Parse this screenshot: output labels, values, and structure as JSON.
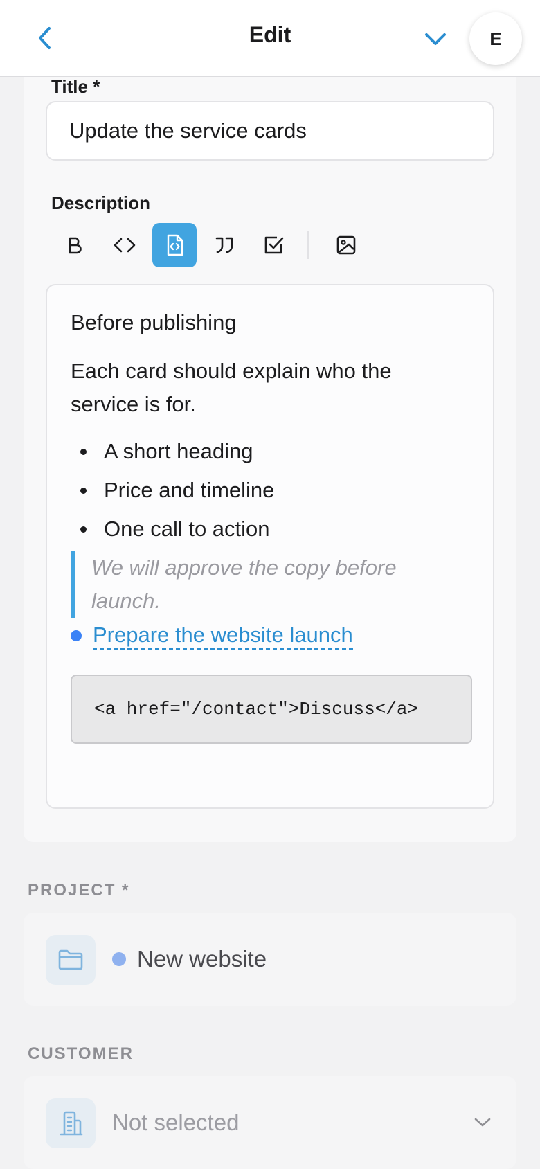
{
  "header": {
    "title": "Edit",
    "avatar_initial": "E"
  },
  "form": {
    "title_label": "Title *",
    "title_value": "Update the service cards",
    "description_label": "Description",
    "toolbar": [
      "bold",
      "inline-code",
      "code-block",
      "quote",
      "checklist",
      "image"
    ],
    "toolbar_active": "code-block"
  },
  "editor": {
    "heading": "Before publishing",
    "paragraph": "Each card should explain who the service is for.",
    "bullets": [
      "A short heading",
      "Price and timeline",
      "One call to action"
    ],
    "quote": "We will approve the copy before launch.",
    "link": "Prepare the website launch",
    "code": "<a href=\"/contact\">Discuss</a>"
  },
  "project": {
    "label": "PROJECT *",
    "value": "New website",
    "dot_color": "#8fb1ef"
  },
  "customer": {
    "label": "CUSTOMER",
    "value": "Not selected"
  },
  "colors": {
    "accent": "#41a4e0",
    "link": "#2a8dd0"
  }
}
